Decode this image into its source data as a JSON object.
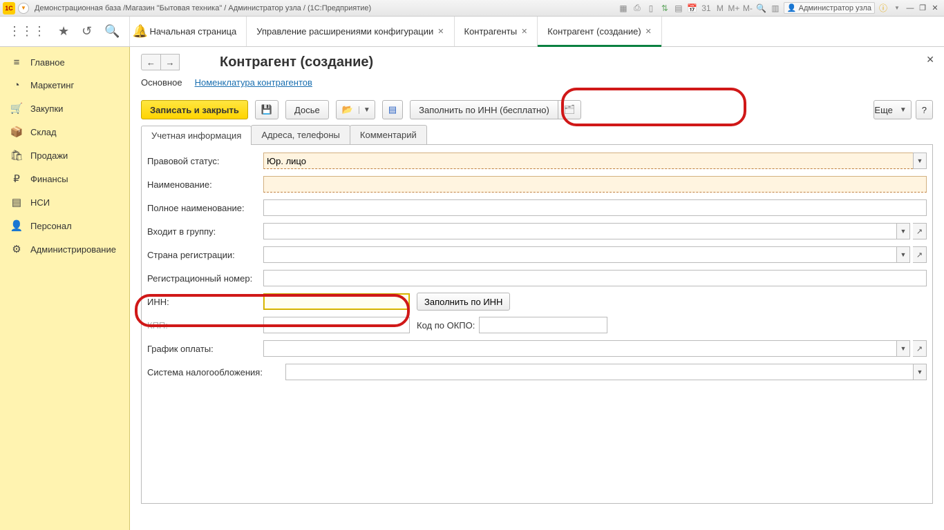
{
  "titlebar": {
    "text": "Демонстрационная база /Магазин \"Бытовая техника\" / Администратор узла /  (1С:Предприятие)",
    "user": "Администратор узла",
    "m_labels": [
      "М",
      "М+",
      "М-"
    ]
  },
  "tabs": {
    "home": "Начальная страница",
    "t1": "Управление расширениями конфигурации",
    "t2": "Контрагенты",
    "t3": "Контрагент (создание)"
  },
  "sidebar": {
    "items": [
      {
        "label": "Главное"
      },
      {
        "label": "Маркетинг"
      },
      {
        "label": "Закупки"
      },
      {
        "label": "Склад"
      },
      {
        "label": "Продажи"
      },
      {
        "label": "Финансы"
      },
      {
        "label": "НСИ"
      },
      {
        "label": "Персонал"
      },
      {
        "label": "Администрирование"
      }
    ]
  },
  "page": {
    "title": "Контрагент (создание)",
    "subtabs": {
      "main": "Основное",
      "nomen": "Номенклатура контрагентов"
    }
  },
  "cmd": {
    "save_close": "Записать и закрыть",
    "dossier": "Досье",
    "fill_inn_free": "Заполнить по ИНН (бесплатно)",
    "more": "Еще",
    "help": "?"
  },
  "formtabs": {
    "t1": "Учетная информация",
    "t2": "Адреса, телефоны",
    "t3": "Комментарий"
  },
  "form": {
    "legal_status_label": "Правовой статус:",
    "legal_status_value": "Юр. лицо",
    "name_label": "Наименование:",
    "full_name_label": "Полное наименование:",
    "group_label": "Входит в группу:",
    "country_label": "Страна регистрации:",
    "reg_num_label": "Регистрационный номер:",
    "inn_label": "ИНН:",
    "fill_by_inn_btn": "Заполнить по ИНН",
    "inn_value": "",
    "kpp_label": "КПП:",
    "okpo_label": "Код по ОКПО:",
    "pay_schedule_label": "График оплаты:",
    "tax_system_label": "Система налогообложения:"
  }
}
